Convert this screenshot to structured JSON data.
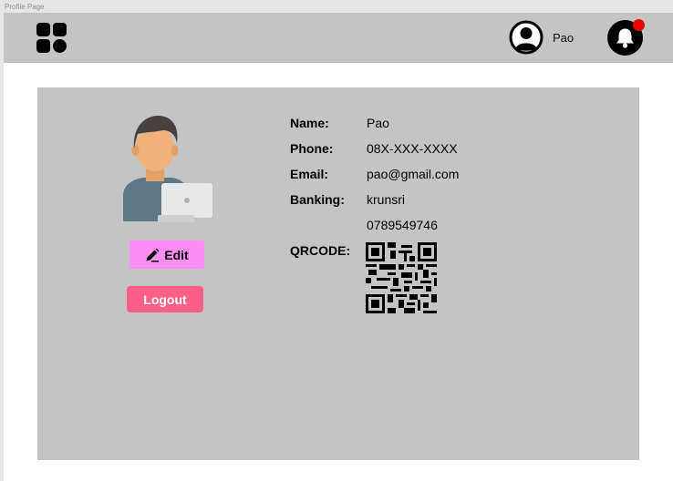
{
  "window": {
    "title": "Profile Page"
  },
  "header": {
    "menu_icon": "grid-menu-icon",
    "user": {
      "name": "Pao",
      "icon": "user-circle-icon"
    },
    "notifications": {
      "icon": "bell-icon",
      "badge_color": "#f00000"
    }
  },
  "profile": {
    "avatar_icon": "person-with-laptop-illustration",
    "edit_button": {
      "label": "Edit",
      "icon": "pencil-icon",
      "color": "#ff8ef7"
    },
    "logout_button": {
      "label": "Logout",
      "color": "#ff5f88"
    }
  },
  "details": {
    "name_label": "Name:",
    "name_value": "Pao",
    "phone_label": "Phone:",
    "phone_value": "08X-XXX-XXXX",
    "email_label": "Email:",
    "email_value": "pao@gmail.com",
    "banking_label": "Banking:",
    "banking_bank": "krunsri",
    "banking_account": "0789549746",
    "qrcode_label": "QRCODE:",
    "qrcode_icon": "qr-code-icon"
  },
  "colors": {
    "header_bg": "#c4c4c4",
    "card_bg": "#c4c4c4",
    "page_bg": "#ffffff"
  }
}
